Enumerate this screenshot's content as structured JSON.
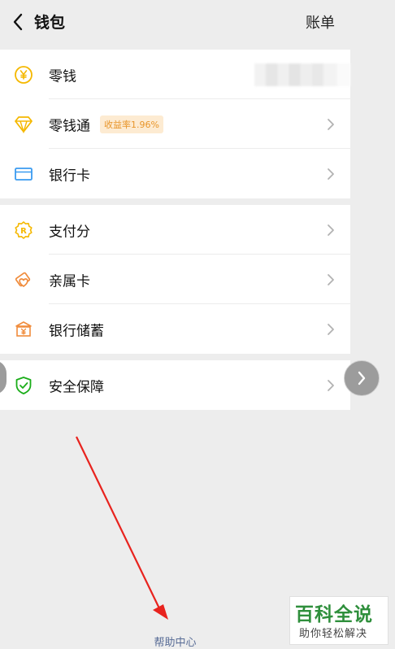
{
  "header": {
    "title": "钱包",
    "bill_label": "账单"
  },
  "group1": [
    {
      "name": "change",
      "label": "零钱",
      "icon": "yuan-coin-icon"
    },
    {
      "name": "change-plus",
      "label": "零钱通",
      "badge": "收益率1.96%",
      "icon": "diamond-icon"
    },
    {
      "name": "bank-card",
      "label": "银行卡",
      "icon": "bank-card-icon"
    }
  ],
  "group2": [
    {
      "name": "pay-score",
      "label": "支付分",
      "icon": "pay-score-icon"
    },
    {
      "name": "family-card",
      "label": "亲属卡",
      "icon": "family-card-icon"
    },
    {
      "name": "bank-savings",
      "label": "银行储蓄",
      "icon": "bank-savings-icon"
    }
  ],
  "group3": [
    {
      "name": "security",
      "label": "安全保障",
      "icon": "shield-icon"
    }
  ],
  "footer": {
    "help_center": "帮助中心"
  },
  "watermark": {
    "title": "百科全说",
    "subtitle": "助你轻松解决"
  },
  "colors": {
    "accent_yellow": "#f5b800",
    "link_blue": "#576b95",
    "security_green": "#1aad19",
    "annotation_red": "#e8231e",
    "watermark_green": "#2f8f3c"
  }
}
